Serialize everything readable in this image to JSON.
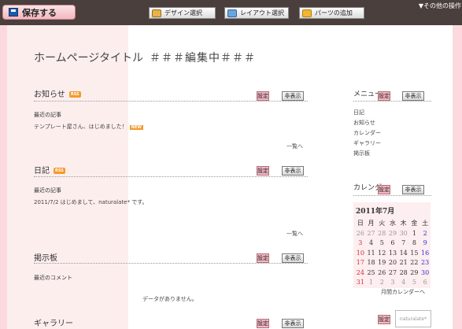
{
  "toolbar": {
    "save_label": "保存する",
    "design_label": "デザイン選択",
    "layout_label": "レイアウト選択",
    "parts_label": "パーツの追加",
    "other_ops": "▼その他の操作"
  },
  "site": {
    "title": "ホームページタイトル",
    "editing": "＃＃＃編集中＃＃＃"
  },
  "buttons": {
    "set": "設定",
    "hide": "非表示"
  },
  "news": {
    "title": "お知らせ",
    "rss": "RSS",
    "label": "最近の記事",
    "item": "テンプレート屋さん、はじめました！",
    "new": "NEW",
    "more": "一覧へ"
  },
  "diary": {
    "title": "日記",
    "rss": "RSS",
    "label": "最近の記事",
    "item": "2011/7/2 はじめまして、naturalate* です。",
    "more": "一覧へ"
  },
  "bbs": {
    "title": "掲示板",
    "label": "最近のコメント",
    "empty": "データがありません。"
  },
  "gallery": {
    "title": "ギャラリー"
  },
  "menu": {
    "title": "メニュー",
    "items": [
      "日記",
      "お知らせ",
      "カレンダー",
      "ギャラリー",
      "掲示板"
    ]
  },
  "calendar": {
    "title": "カレンダー",
    "month": "2011年7月",
    "weekdays": [
      "日",
      "月",
      "火",
      "水",
      "木",
      "金",
      "土"
    ],
    "weeks": [
      [
        "26",
        "27",
        "28",
        "29",
        "30",
        "1",
        "2"
      ],
      [
        "3",
        "4",
        "5",
        "6",
        "7",
        "8",
        "9"
      ],
      [
        "10",
        "11",
        "12",
        "13",
        "14",
        "15",
        "16"
      ],
      [
        "17",
        "18",
        "19",
        "20",
        "21",
        "22",
        "23"
      ],
      [
        "24",
        "25",
        "26",
        "27",
        "28",
        "29",
        "30"
      ],
      [
        "31",
        "1",
        "2",
        "3",
        "4",
        "5",
        "6"
      ]
    ],
    "link": "月間カレンダーへ"
  },
  "watermark": "naturalate*"
}
